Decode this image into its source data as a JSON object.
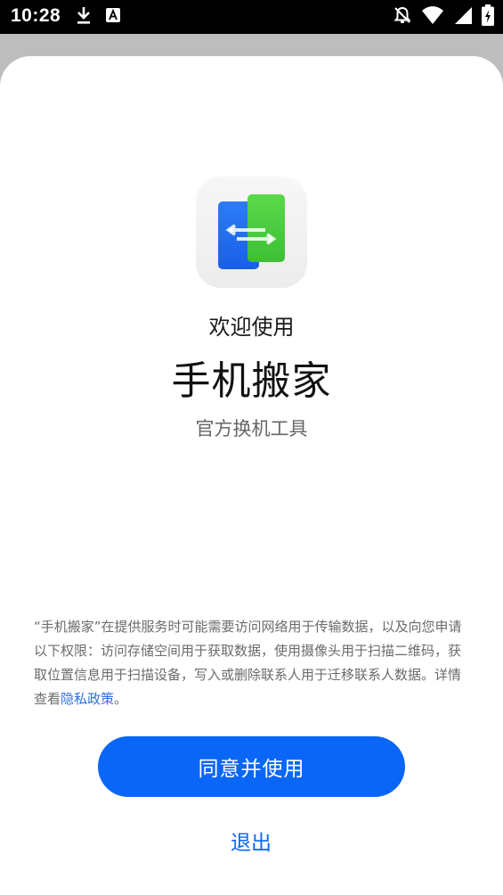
{
  "status_bar": {
    "time": "10:28",
    "left_icons": [
      "download-icon",
      "a-icon"
    ],
    "right_icons": [
      "notifications-off-icon",
      "wifi-icon",
      "cell-signal-icon",
      "battery-charging-icon"
    ]
  },
  "dialog": {
    "welcome": "欢迎使用",
    "app_name": "手机搬家",
    "tagline": "官方换机工具",
    "notice_text": "“手机搬家”在提供服务时可能需要访问网络用于传输数据，以及向您申请以下权限：访问存储空间用于获取数据，使用摄像头用于扫描二维码，获取位置信息用于扫描设备，写入或删除联系人用于迁移联系人数据。详情查看",
    "privacy_link": "隐私政策",
    "notice_end": "。",
    "agree_label": "同意并使用",
    "exit_label": "退出"
  },
  "colors": {
    "accent": "#0a66f7",
    "link": "#2f6fe0",
    "icon_blue": "#1f6ff0",
    "icon_green": "#47c93a"
  }
}
